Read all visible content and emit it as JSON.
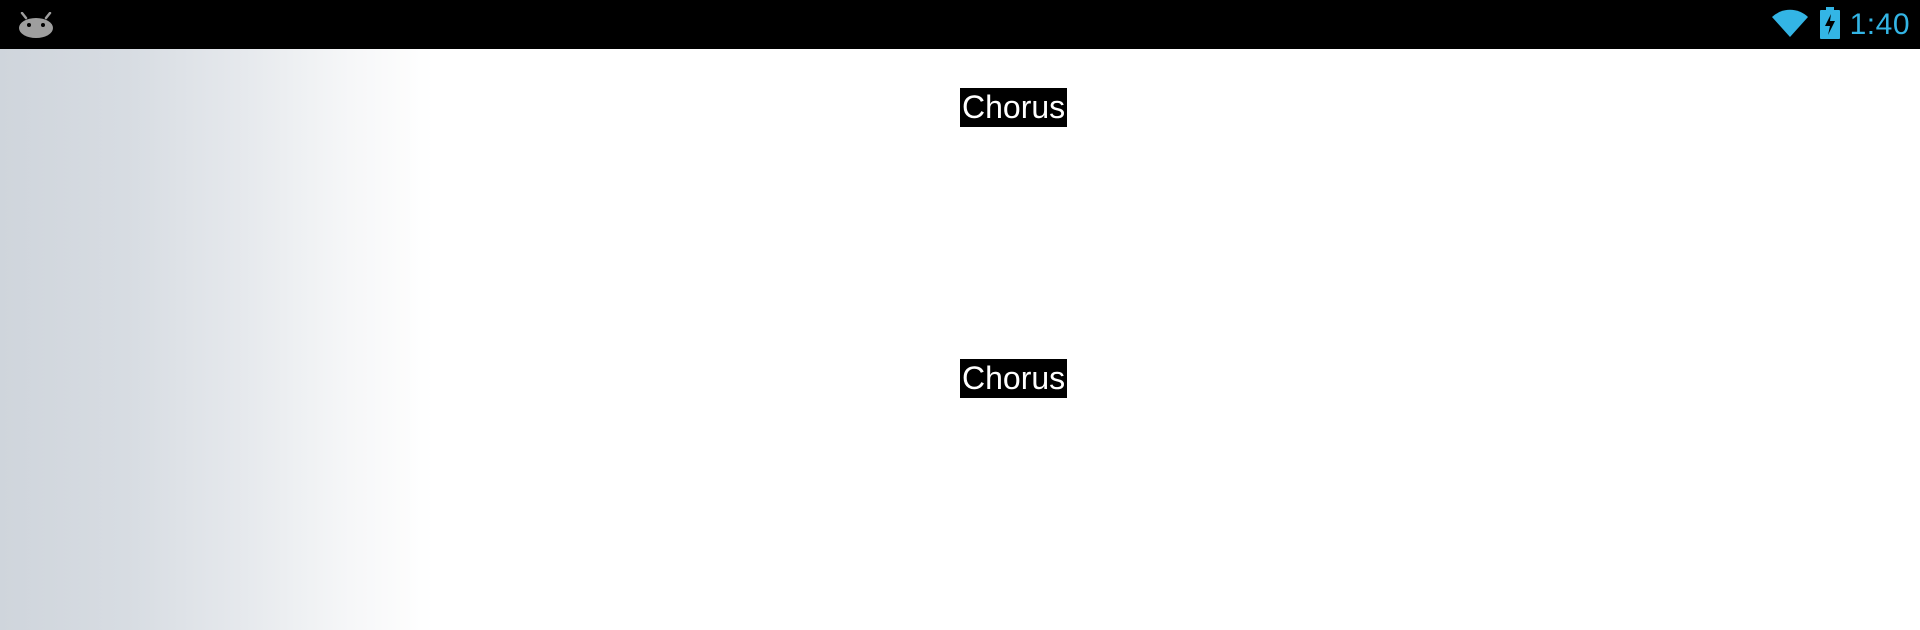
{
  "status_bar": {
    "time": "1:40",
    "icons": [
      "android-icon",
      "wifi-icon",
      "battery-charging-icon"
    ],
    "accent_color": "#33b5e5"
  },
  "lyrics": {
    "sections": [
      {
        "label": "Chorus"
      },
      {
        "label": "Chorus"
      }
    ]
  }
}
